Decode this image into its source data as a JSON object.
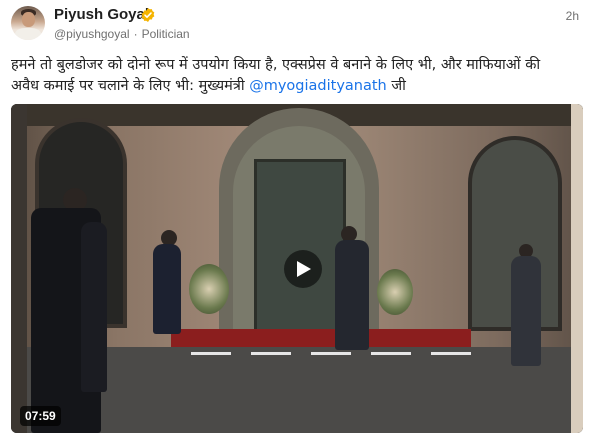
{
  "post": {
    "author_name": "Piyush Goyal",
    "handle": "@piyushgoyal",
    "separator": "·",
    "role": "Politician",
    "timestamp": "2h",
    "text_before_mention": "हमने तो बुलडोजर को दोनो रूप में उपयोग किया है, एक्सप्रेस वे बनाने के लिए भी, और माफियाओं की अवैध कमाई पर चलाने के लिए भी: मुख्यमंत्री ",
    "mention": "@myogiadityanath",
    "text_after_mention": " जी"
  },
  "video": {
    "duration": "07:59"
  },
  "icons": {
    "verified": "verified-badge-icon",
    "play": "play-icon"
  },
  "colors": {
    "verified_badge": "#f5b400",
    "mention": "#1a73e8",
    "meta_text": "#707070"
  }
}
